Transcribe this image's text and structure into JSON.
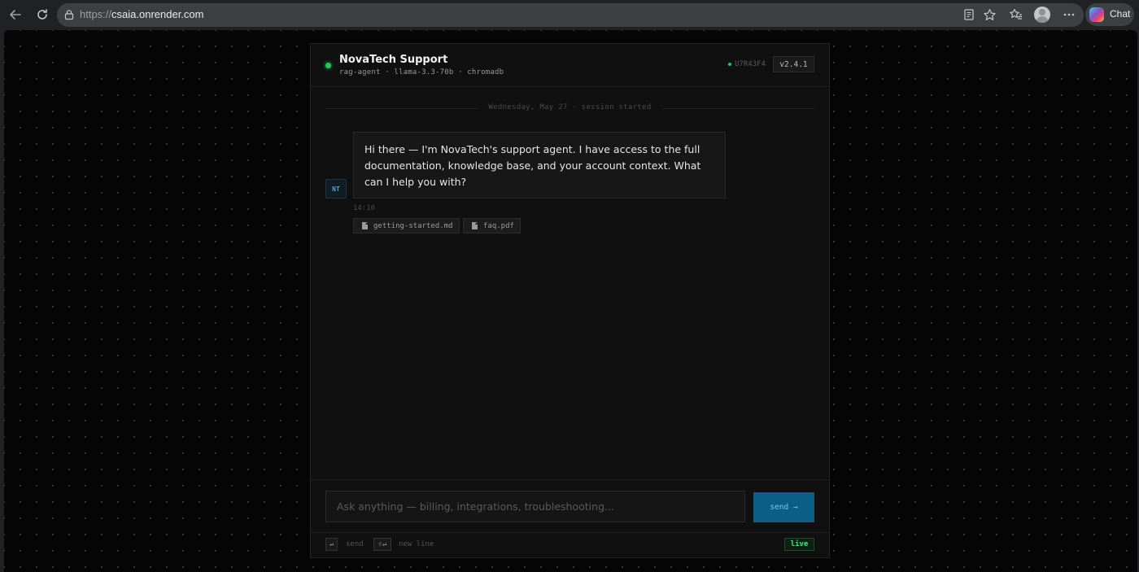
{
  "browser": {
    "url_scheme": "https://",
    "url_host": "csaia.onrender.com",
    "chat_label": "Chat"
  },
  "header": {
    "title": "NovaTech Support",
    "subtitle": "rag-agent · llama-3.3-70b · chromadb",
    "session_id": "U7R43F4",
    "version": "v2.4.1"
  },
  "conversation": {
    "divider": "Wednesday, May 27 · session started",
    "messages": [
      {
        "avatar": "NT",
        "text": "Hi there — I'm NovaTech's support agent. I have access to the full documentation, knowledge base, and your account context. What can I help you with?",
        "time": "14:10",
        "sources": [
          "getting-started.md",
          "faq.pdf"
        ]
      }
    ]
  },
  "composer": {
    "placeholder": "Ask anything — billing, integrations, troubleshooting...",
    "value": "",
    "send_label": "send →"
  },
  "footer": {
    "send_key": "↵",
    "send_hint": "send",
    "newline_key": "⇧↵",
    "newline_hint": "new line",
    "status": "live"
  },
  "colors": {
    "accent": "#0b5f86",
    "status_green": "#22c55e",
    "background": "#050505"
  }
}
